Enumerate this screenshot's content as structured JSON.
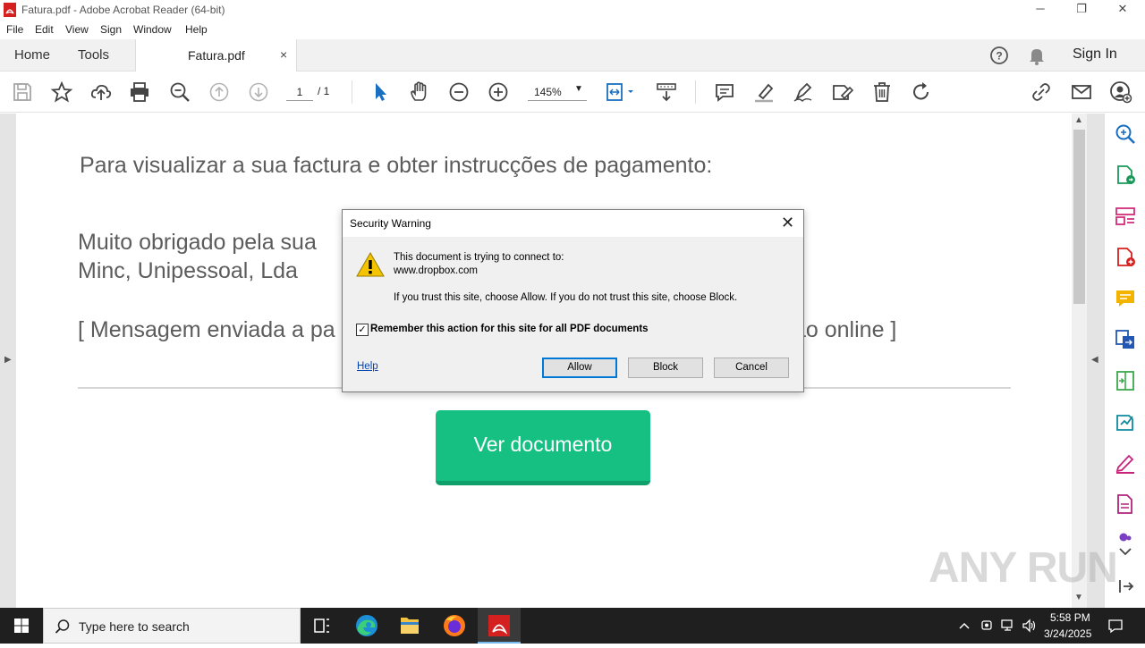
{
  "window": {
    "title": "Fatura.pdf - Adobe Acrobat Reader (64-bit)",
    "minimize": "─",
    "maximize": "❐",
    "close": "✕"
  },
  "menu": [
    "File",
    "Edit",
    "View",
    "Sign",
    "Window",
    "Help"
  ],
  "tabs": {
    "home": "Home",
    "tools": "Tools",
    "document": "Fatura.pdf",
    "close": "×",
    "sign_in": "Sign In"
  },
  "toolbar": {
    "page_current": "1",
    "page_total": "/ 1",
    "zoom": "145%",
    "zoom_caret": "▼"
  },
  "document": {
    "heading": "Para visualizar a sua factura e obter instrucções de pagamento:",
    "line1": "Muito obrigado pela sua",
    "line2": "Minc, Unipessoal, Lda",
    "line3": "[ Mensagem enviada a pa",
    "line3_end": "ão online ]",
    "button": "Ver documento"
  },
  "dialog": {
    "title": "Security Warning",
    "close": "✕",
    "line1": "This document is trying to connect to:",
    "line2": "www.dropbox.com",
    "line3": "If you trust this site, choose Allow. If you do not trust this site, choose Block.",
    "remember_label": "Remember this action for this site for all PDF documents",
    "remember_checked": "✓",
    "help": "Help",
    "allow": "Allow",
    "block": "Block",
    "cancel": "Cancel"
  },
  "scroll": {
    "up": "▲",
    "down": "▼",
    "left_collapse": "▶",
    "right_collapse": "◀"
  },
  "watermark": "ANY RUN",
  "taskbar": {
    "search_placeholder": "Type here to search",
    "time": "5:58 PM",
    "date": "3/24/2025"
  },
  "colors": {
    "accent": "#0078d7",
    "doc_button": "#16c083",
    "acrobat_red": "#d4201f",
    "icon_blue": "#1a6fc0"
  }
}
